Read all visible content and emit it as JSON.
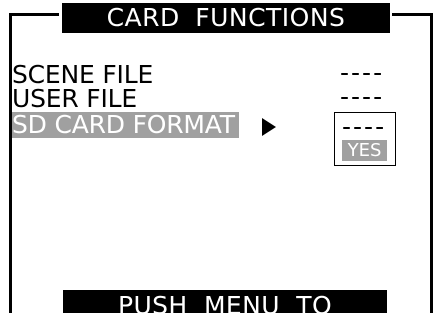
{
  "header": {
    "title": "CARD FUNCTIONS"
  },
  "menu": {
    "items": [
      {
        "label": "SCENE FILE",
        "value": "----"
      },
      {
        "label": "USER FILE",
        "value": "----"
      },
      {
        "label": "SD CARD FORMAT",
        "value": ""
      }
    ],
    "submenu": {
      "dashes": "----",
      "option": "YES"
    },
    "arrow_icon": "right-triangle-icon"
  },
  "footer": {
    "text": "PUSH MENU TO RETURN"
  },
  "colors": {
    "background": "#ffffff",
    "foreground": "#000000",
    "highlight": "#a0a0a0"
  }
}
